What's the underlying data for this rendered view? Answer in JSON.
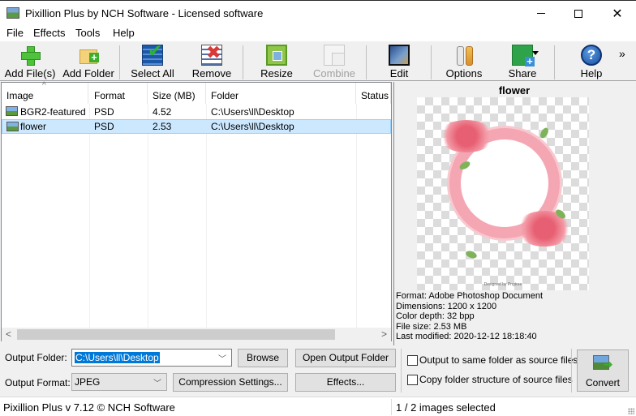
{
  "window": {
    "title": "Pixillion Plus by NCH Software - Licensed software",
    "minimize": "minimize",
    "maximize": "maximize",
    "close": "✕"
  },
  "menu": [
    "File",
    "Effects",
    "Tools",
    "Help"
  ],
  "toolbar": {
    "add_files": "Add File(s)",
    "add_folder": "Add Folder",
    "select_all": "Select All",
    "remove": "Remove",
    "resize": "Resize",
    "combine": "Combine",
    "edit": "Edit",
    "options": "Options",
    "share": "Share",
    "help": "Help",
    "help_glyph": "?",
    "overflow": "»"
  },
  "list": {
    "columns": [
      "Image",
      "Format",
      "Size (MB)",
      "Folder",
      "Status"
    ],
    "sort_indicator": "^",
    "rows": [
      {
        "image": "BGR2-featured",
        "format": "PSD",
        "size": "4.52",
        "folder": "C:\\Users\\ll\\Desktop",
        "status": "",
        "selected": false
      },
      {
        "image": "flower",
        "format": "PSD",
        "size": "2.53",
        "folder": "C:\\Users\\ll\\Desktop",
        "status": "",
        "selected": true
      }
    ],
    "scroll_left": "<",
    "scroll_right": ">"
  },
  "preview": {
    "title": "flower",
    "watermark": "Designed by Pngtree",
    "info": [
      "Format: Adobe Photoshop Document",
      "Dimensions: 1200 x 1200",
      "Color depth: 32 bpp",
      "File size: 2.53 MB",
      "Last modified: 2020-12-12 18:18:40"
    ]
  },
  "output": {
    "folder_label": "Output Folder:",
    "folder_value": "C:\\Users\\ll\\Desktop",
    "browse": "Browse",
    "open_output_folder": "Open Output Folder",
    "format_label": "Output Format:",
    "format_value": "JPEG",
    "compression_settings": "Compression Settings...",
    "effects": "Effects...",
    "same_folder": "Output to same folder as source files",
    "same_folder_checked": false,
    "copy_structure": "Copy folder structure of source files",
    "copy_structure_checked": false,
    "convert": "Convert",
    "caret": "﹀"
  },
  "status": {
    "version": "Pixillion Plus v 7.12 © NCH Software",
    "selection": "1 / 2 images selected"
  }
}
